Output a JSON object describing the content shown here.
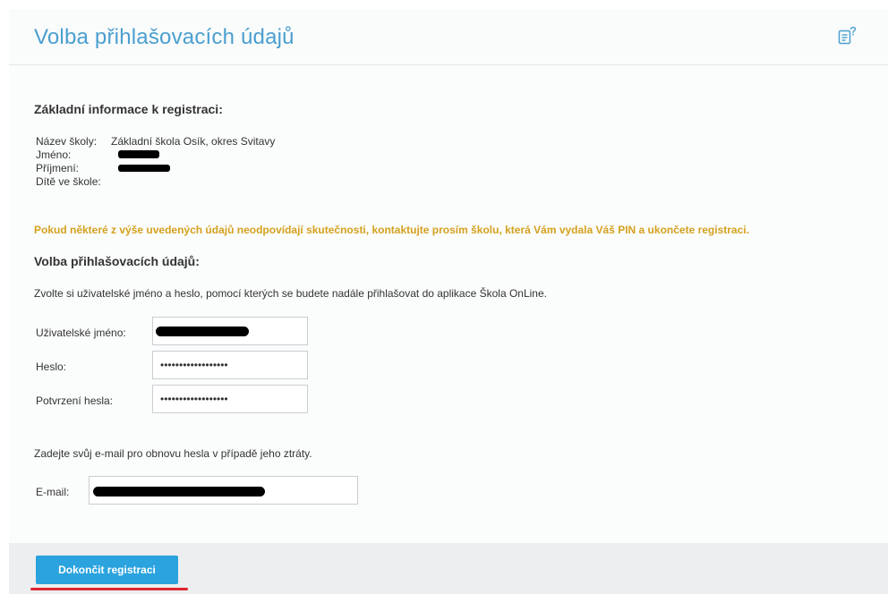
{
  "header": {
    "title": "Volba přihlašovacích údajů",
    "help_icon": "help-document-icon"
  },
  "basic_info": {
    "heading": "Základní informace k registraci:",
    "rows": [
      {
        "label": "Název školy:",
        "value": "Základní škola Osík, okres Svitavy"
      },
      {
        "label": "Jméno:",
        "value": ""
      },
      {
        "label": "Příjmení:",
        "value": ""
      },
      {
        "label": "Dítě ve škole:",
        "value": ""
      }
    ]
  },
  "warning": {
    "text": "Pokud některé z výše uvedených údajů neodpovídají skutečnosti, kontaktujte prosím školu, která Vám vydala Váš PIN a ukončete registraci.",
    "color": "#d4a11e"
  },
  "login": {
    "heading": "Volba přihlašovacích údajů:",
    "hint": "Zvolte si uživatelské jméno a heslo, pomocí kterých se budete nadále přihlašovat do aplikace Škola OnLine.",
    "username_label": "Uživatelské jméno:",
    "username_value": "",
    "password_label": "Heslo:",
    "password_value": "••••••••••••••••••",
    "confirm_label": "Potvrzení hesla:",
    "confirm_value": "••••••••••••••••••"
  },
  "email": {
    "hint": "Zadejte svůj e-mail pro obnovu hesla v případě jeho ztráty.",
    "label": "E-mail:",
    "value": ""
  },
  "footer": {
    "submit_label": "Dokončit registraci"
  },
  "colors": {
    "title": "#4a9fd0",
    "primary_button": "#2aa3de",
    "footer_bg": "#eceef0",
    "annotation_underline": "#e0262f"
  }
}
